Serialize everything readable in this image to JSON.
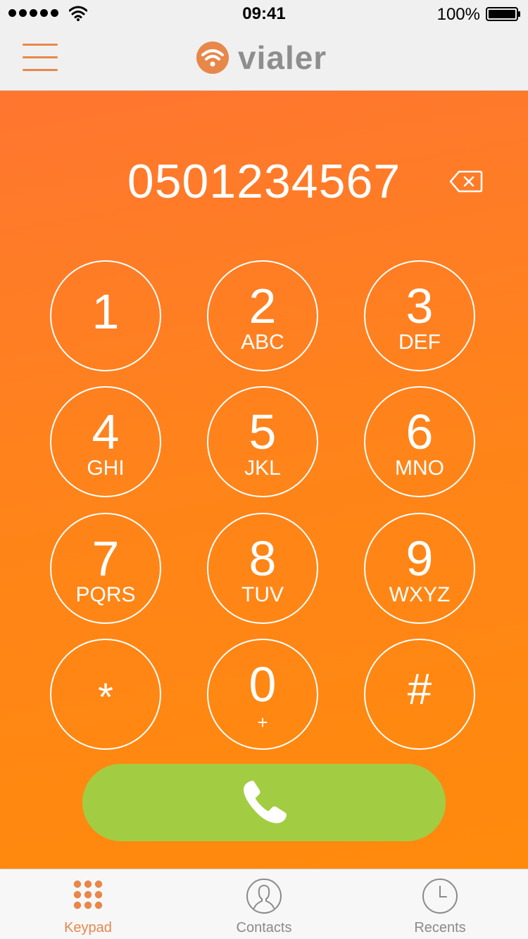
{
  "status_bar": {
    "time": "09:41",
    "battery": "100%",
    "signal_icon": "signal-dots-icon",
    "wifi_icon": "wifi-icon",
    "battery_icon": "battery-icon"
  },
  "nav": {
    "menu_icon": "hamburger-menu-icon",
    "logo_text": "vialer",
    "logo_icon": "vialer-wifi-logo-icon",
    "accent_color": "#e8874a"
  },
  "dialer": {
    "number": "0501234567",
    "backspace_icon": "backspace-icon",
    "keys": [
      {
        "digit": "1",
        "letters": ""
      },
      {
        "digit": "2",
        "letters": "ABC"
      },
      {
        "digit": "3",
        "letters": "DEF"
      },
      {
        "digit": "4",
        "letters": "GHI"
      },
      {
        "digit": "5",
        "letters": "JKL"
      },
      {
        "digit": "6",
        "letters": "MNO"
      },
      {
        "digit": "7",
        "letters": "PQRS"
      },
      {
        "digit": "8",
        "letters": "TUV"
      },
      {
        "digit": "9",
        "letters": "WXYZ"
      },
      {
        "digit": "*",
        "letters": ""
      },
      {
        "digit": "0",
        "letters": "+"
      },
      {
        "digit": "#",
        "letters": ""
      }
    ],
    "call_icon": "phone-icon",
    "background_color": "#ff8419",
    "call_color": "#a2cd43"
  },
  "tabs": [
    {
      "label": "Keypad",
      "icon": "keypad-grid-icon",
      "active": true
    },
    {
      "label": "Contacts",
      "icon": "contacts-person-icon",
      "active": false
    },
    {
      "label": "Recents",
      "icon": "clock-icon",
      "active": false
    }
  ]
}
